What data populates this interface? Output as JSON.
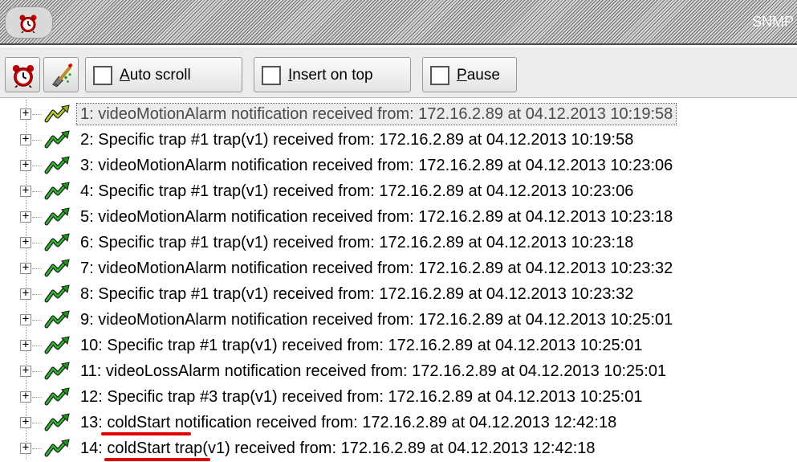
{
  "window": {
    "title": "SNMP",
    "icon": "alarm-clock-icon"
  },
  "toolbar": {
    "alarm_button_icon": "alarm-clock-icon",
    "clear_button_icon": "eraser-brush-icon",
    "auto_scroll": {
      "label_accel": "A",
      "label_rest": "uto scroll",
      "checked": false
    },
    "insert_on_top": {
      "label_accel": "I",
      "label_rest": "nsert on top",
      "checked": false
    },
    "pause": {
      "label_accel": "P",
      "label_rest": "ause",
      "checked": false
    }
  },
  "tree": {
    "expander_glyph": "+",
    "item_icon": "trap-arrow-icon",
    "highlight_color": "#e00000",
    "items": [
      {
        "text": "1: videoMotionAlarm notification received from: 172.16.2.89 at 04.12.2013 10:19:58",
        "selected": true
      },
      {
        "text": "2: Specific trap #1 trap(v1) received from: 172.16.2.89 at 04.12.2013 10:19:58"
      },
      {
        "text": "3: videoMotionAlarm notification received from: 172.16.2.89 at 04.12.2013 10:23:06"
      },
      {
        "text": "4: Specific trap #1 trap(v1) received from: 172.16.2.89 at 04.12.2013 10:23:06"
      },
      {
        "text": "5: videoMotionAlarm notification received from: 172.16.2.89 at 04.12.2013 10:23:18"
      },
      {
        "text": "6: Specific trap #1 trap(v1) received from: 172.16.2.89 at 04.12.2013 10:23:18"
      },
      {
        "text": "7: videoMotionAlarm notification received from: 172.16.2.89 at 04.12.2013 10:23:32"
      },
      {
        "text": "8: Specific trap #1 trap(v1) received from: 172.16.2.89 at 04.12.2013 10:23:32"
      },
      {
        "text": "9: videoMotionAlarm notification received from: 172.16.2.89 at 04.12.2013 10:25:01"
      },
      {
        "text": "10: Specific trap #1 trap(v1) received from: 172.16.2.89 at 04.12.2013 10:25:01"
      },
      {
        "text": "11: videoLossAlarm notification received from: 172.16.2.89 at 04.12.2013 10:25:01"
      },
      {
        "text": "12: Specific trap #3 trap(v1) received from: 172.16.2.89 at 04.12.2013 10:25:01"
      },
      {
        "text": "13: coldStart notification received from: 172.16.2.89 at 04.12.2013 12:42:18",
        "highlighted": true
      },
      {
        "text": "14: coldStart trap(v1) received from: 172.16.2.89 at 04.12.2013 12:42:18",
        "highlighted": true
      }
    ]
  }
}
